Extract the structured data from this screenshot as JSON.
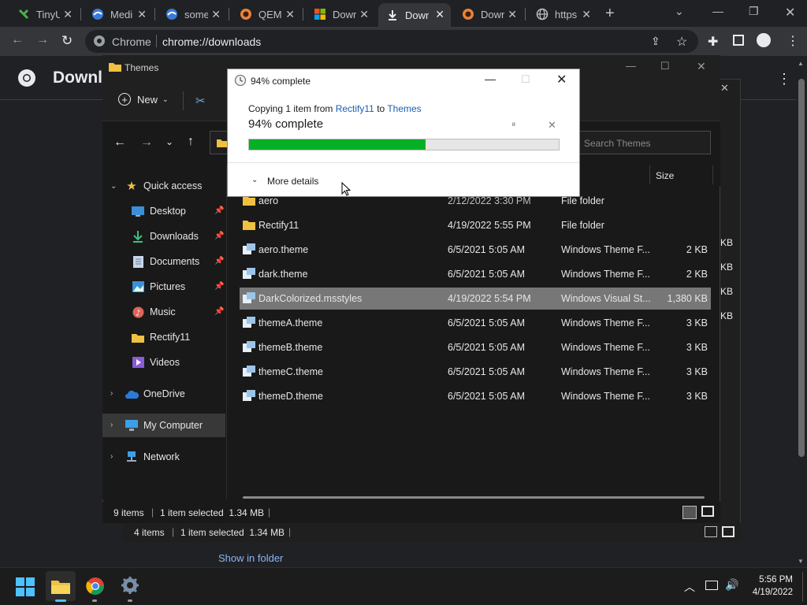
{
  "browser": {
    "tabs": [
      {
        "title": "TinyU"
      },
      {
        "title": "Medi"
      },
      {
        "title": "some"
      },
      {
        "title": "QEMI"
      },
      {
        "title": "Dowr"
      },
      {
        "title": "Dowr"
      },
      {
        "title": "Dowr"
      },
      {
        "title": "https"
      }
    ],
    "omnibox_scheme": "Chrome",
    "omnibox_url": "chrome://downloads"
  },
  "downloads_page": {
    "title": "Downl",
    "show_in_folder": "Show in folder"
  },
  "explorer": {
    "title": "Themes",
    "new_label": "New",
    "search_placeholder": "Search Themes",
    "size_header": "Size",
    "sidebar": [
      {
        "label": "Quick access"
      },
      {
        "label": "Desktop"
      },
      {
        "label": "Downloads"
      },
      {
        "label": "Documents"
      },
      {
        "label": "Pictures"
      },
      {
        "label": "Music"
      },
      {
        "label": "Rectify11"
      },
      {
        "label": "Videos"
      },
      {
        "label": "OneDrive"
      },
      {
        "label": "My Computer"
      },
      {
        "label": "Network"
      }
    ],
    "files": [
      {
        "name": "aero",
        "date": "2/12/2022 3:30 PM",
        "type": "File folder",
        "size": ""
      },
      {
        "name": "Rectify11",
        "date": "4/19/2022 5:55 PM",
        "type": "File folder",
        "size": ""
      },
      {
        "name": "aero.theme",
        "date": "6/5/2021 5:05 AM",
        "type": "Windows Theme F...",
        "size": "2 KB"
      },
      {
        "name": "dark.theme",
        "date": "6/5/2021 5:05 AM",
        "type": "Windows Theme F...",
        "size": "2 KB"
      },
      {
        "name": "DarkColorized.msstyles",
        "date": "4/19/2022 5:54 PM",
        "type": "Windows Visual St...",
        "size": "1,380 KB"
      },
      {
        "name": "themeA.theme",
        "date": "6/5/2021 5:05 AM",
        "type": "Windows Theme F...",
        "size": "3 KB"
      },
      {
        "name": "themeB.theme",
        "date": "6/5/2021 5:05 AM",
        "type": "Windows Theme F...",
        "size": "3 KB"
      },
      {
        "name": "themeC.theme",
        "date": "6/5/2021 5:05 AM",
        "type": "Windows Theme F...",
        "size": "3 KB"
      },
      {
        "name": "themeD.theme",
        "date": "6/5/2021 5:05 AM",
        "type": "Windows Theme F...",
        "size": "3 KB"
      }
    ],
    "status_items": "9 items",
    "status_selected": "1 item selected  1.34 MB"
  },
  "explorer_back": {
    "status_items": "4 items",
    "status_selected": "1 item selected  1.34 MB",
    "sizes": [
      "KB",
      "KB",
      "KB",
      "KB"
    ]
  },
  "dialog": {
    "title": "94% complete",
    "copy_prefix": "Copying 1 item from ",
    "copy_source": "Rectify11",
    "copy_mid": " to ",
    "copy_dest": "Themes",
    "big_status": "94% complete",
    "progress_fraction": 0.57,
    "more_details": "More details"
  },
  "taskbar": {
    "time": "5:56 PM",
    "date": "4/19/2022"
  },
  "colors": {
    "progress": "#06b025",
    "link": "#1a5fb4",
    "selection": "#777777"
  }
}
